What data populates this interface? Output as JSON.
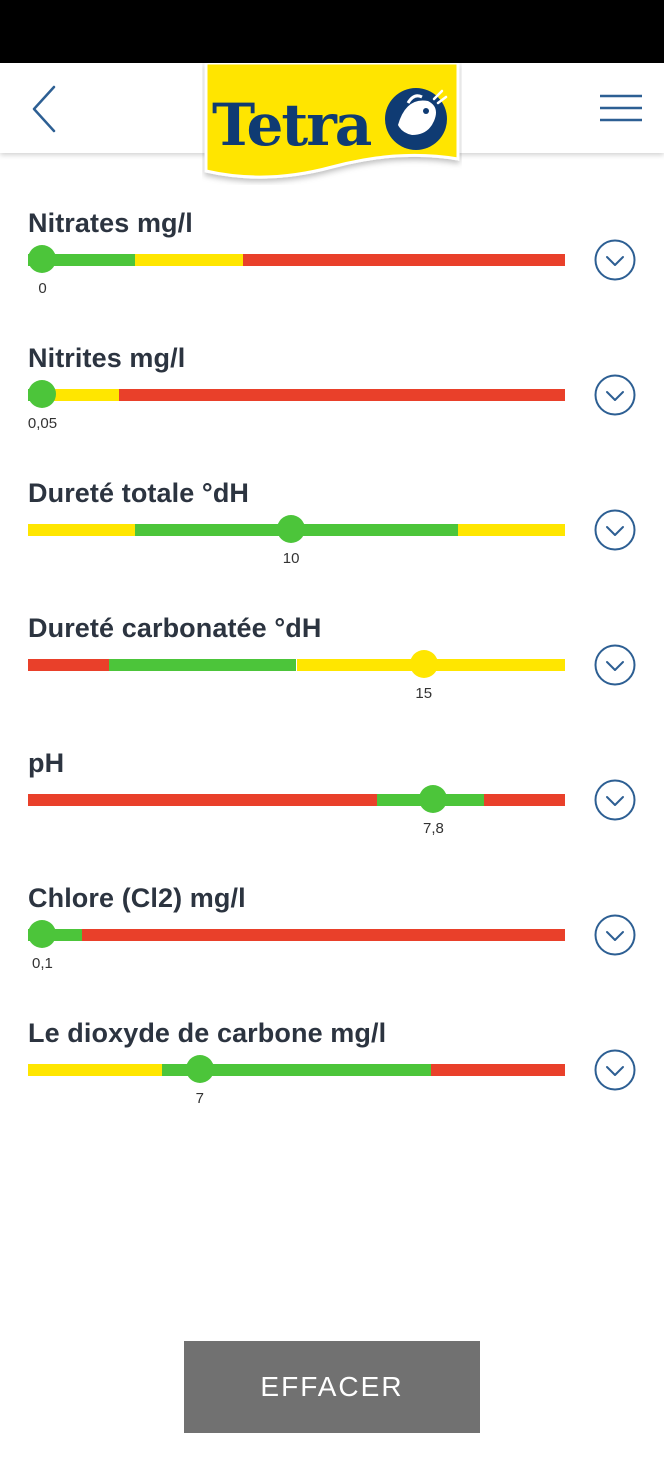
{
  "header": {
    "brand": "Tetra",
    "back_icon": "chevron-left-icon",
    "menu_icon": "hamburger-menu-icon"
  },
  "colors": {
    "green": "#4cc53a",
    "yellow": "#ffe600",
    "red": "#e9402a",
    "brand_yellow": "#ffe500",
    "brand_blue": "#0f3b73",
    "icon_blue": "#2d5f93",
    "button_gray": "#717171"
  },
  "parameters": [
    {
      "title": "Nitrates mg/l",
      "value": "0",
      "position": 0.027,
      "thumb_color": "green",
      "segments": [
        {
          "color": "green",
          "start": 0.0,
          "end": 0.2
        },
        {
          "color": "yellow",
          "start": 0.2,
          "end": 0.4
        },
        {
          "color": "red",
          "start": 0.4,
          "end": 1.0
        }
      ]
    },
    {
      "title": "Nitrites mg/l",
      "value": "0,05",
      "position": 0.027,
      "thumb_color": "green",
      "segments": [
        {
          "color": "green",
          "start": 0.0,
          "end": 0.04
        },
        {
          "color": "yellow",
          "start": 0.04,
          "end": 0.17
        },
        {
          "color": "red",
          "start": 0.17,
          "end": 1.0
        }
      ]
    },
    {
      "title": "Dureté totale °dH",
      "value": "10",
      "position": 0.49,
      "thumb_color": "green",
      "segments": [
        {
          "color": "yellow",
          "start": 0.0,
          "end": 0.2
        },
        {
          "color": "green",
          "start": 0.2,
          "end": 0.8
        },
        {
          "color": "yellow",
          "start": 0.8,
          "end": 1.0
        }
      ]
    },
    {
      "title": "Dureté carbonatée °dH",
      "value": "15",
      "position": 0.737,
      "thumb_color": "yellow",
      "segments": [
        {
          "color": "red",
          "start": 0.0,
          "end": 0.15
        },
        {
          "color": "green",
          "start": 0.15,
          "end": 0.5
        },
        {
          "color": "yellow",
          "start": 0.5,
          "end": 1.0
        }
      ]
    },
    {
      "title": "pH",
      "value": "7,8",
      "position": 0.755,
      "thumb_color": "green",
      "segments": [
        {
          "color": "red",
          "start": 0.0,
          "end": 0.65
        },
        {
          "color": "green",
          "start": 0.65,
          "end": 0.85
        },
        {
          "color": "red",
          "start": 0.85,
          "end": 1.0
        }
      ]
    },
    {
      "title": "Chlore (Cl2) mg/l",
      "value": "0,1",
      "position": 0.027,
      "thumb_color": "green",
      "segments": [
        {
          "color": "green",
          "start": 0.0,
          "end": 0.1
        },
        {
          "color": "red",
          "start": 0.1,
          "end": 1.0
        }
      ]
    },
    {
      "title": "Le dioxyde de carbone mg/l",
      "value": "7",
      "position": 0.32,
      "thumb_color": "green",
      "segments": [
        {
          "color": "yellow",
          "start": 0.0,
          "end": 0.25
        },
        {
          "color": "green",
          "start": 0.25,
          "end": 0.75
        },
        {
          "color": "red",
          "start": 0.75,
          "end": 1.0
        }
      ]
    }
  ],
  "expand_icon": "chevron-down-circle-icon",
  "clear_button": {
    "label": "EFFACER"
  }
}
